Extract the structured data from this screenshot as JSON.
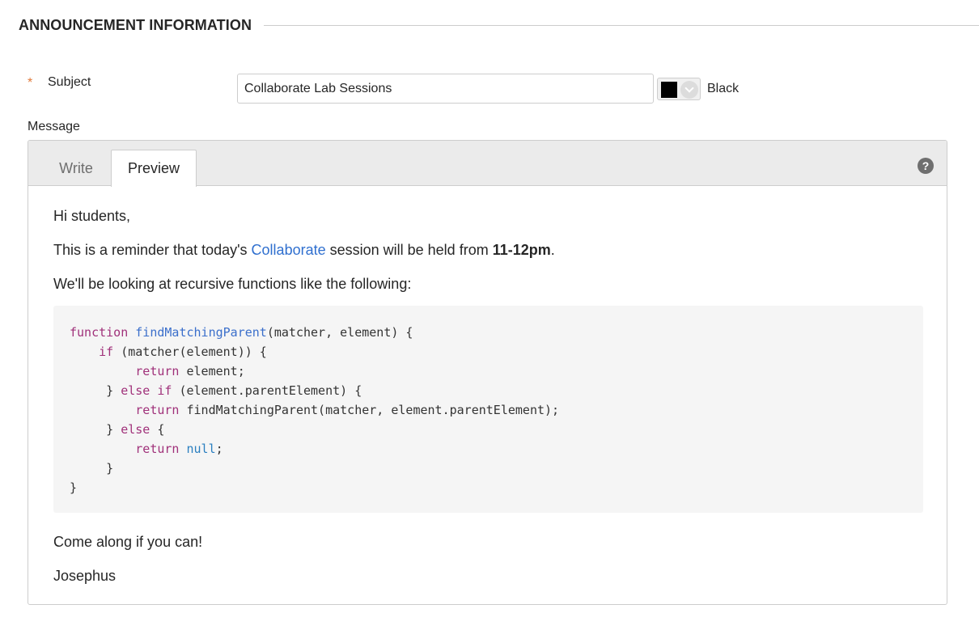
{
  "section": {
    "title": "ANNOUNCEMENT INFORMATION"
  },
  "subject": {
    "required_mark": "*",
    "label": "Subject",
    "value": "Collaborate Lab Sessions",
    "color_name": "Black",
    "color_value": "#000000"
  },
  "message": {
    "label": "Message",
    "tabs": {
      "write": "Write",
      "preview": "Preview"
    },
    "active_tab": "Preview",
    "help_icon": "?",
    "greeting": "Hi students,",
    "reminder": {
      "before": "This is a reminder that today's ",
      "link": "Collaborate",
      "middle": " session will be held from ",
      "time": "11-12pm",
      "after": "."
    },
    "looking": "We'll be looking at recursive functions like the following:",
    "code": {
      "line1": {
        "kw": "function",
        "fn": "findMatchingParent",
        "rest": "(matcher, element) {"
      },
      "line2": {
        "indent": "    ",
        "kw": "if",
        "rest": " (matcher(element)) {"
      },
      "line3": {
        "indent": "         ",
        "kw": "return",
        "rest": " element;"
      },
      "line4": {
        "indent": "     } ",
        "kw": "else if",
        "rest": " (element.parentElement) {"
      },
      "line5": {
        "indent": "         ",
        "kw": "return",
        "rest": " findMatchingParent(matcher, element.parentElement);"
      },
      "line6": {
        "indent": "     } ",
        "kw": "else",
        "rest": " {"
      },
      "line7": {
        "indent": "         ",
        "kw": "return",
        "nul": "null",
        "rest": ";"
      },
      "line8": "     }",
      "line9": "}"
    },
    "closing": "Come along if you can!",
    "signature": "Josephus"
  },
  "colors": {
    "link": "#2f6fcf",
    "required": "#e07a3b",
    "code_keyword": "#a0317a",
    "code_function": "#3b6fcb"
  }
}
